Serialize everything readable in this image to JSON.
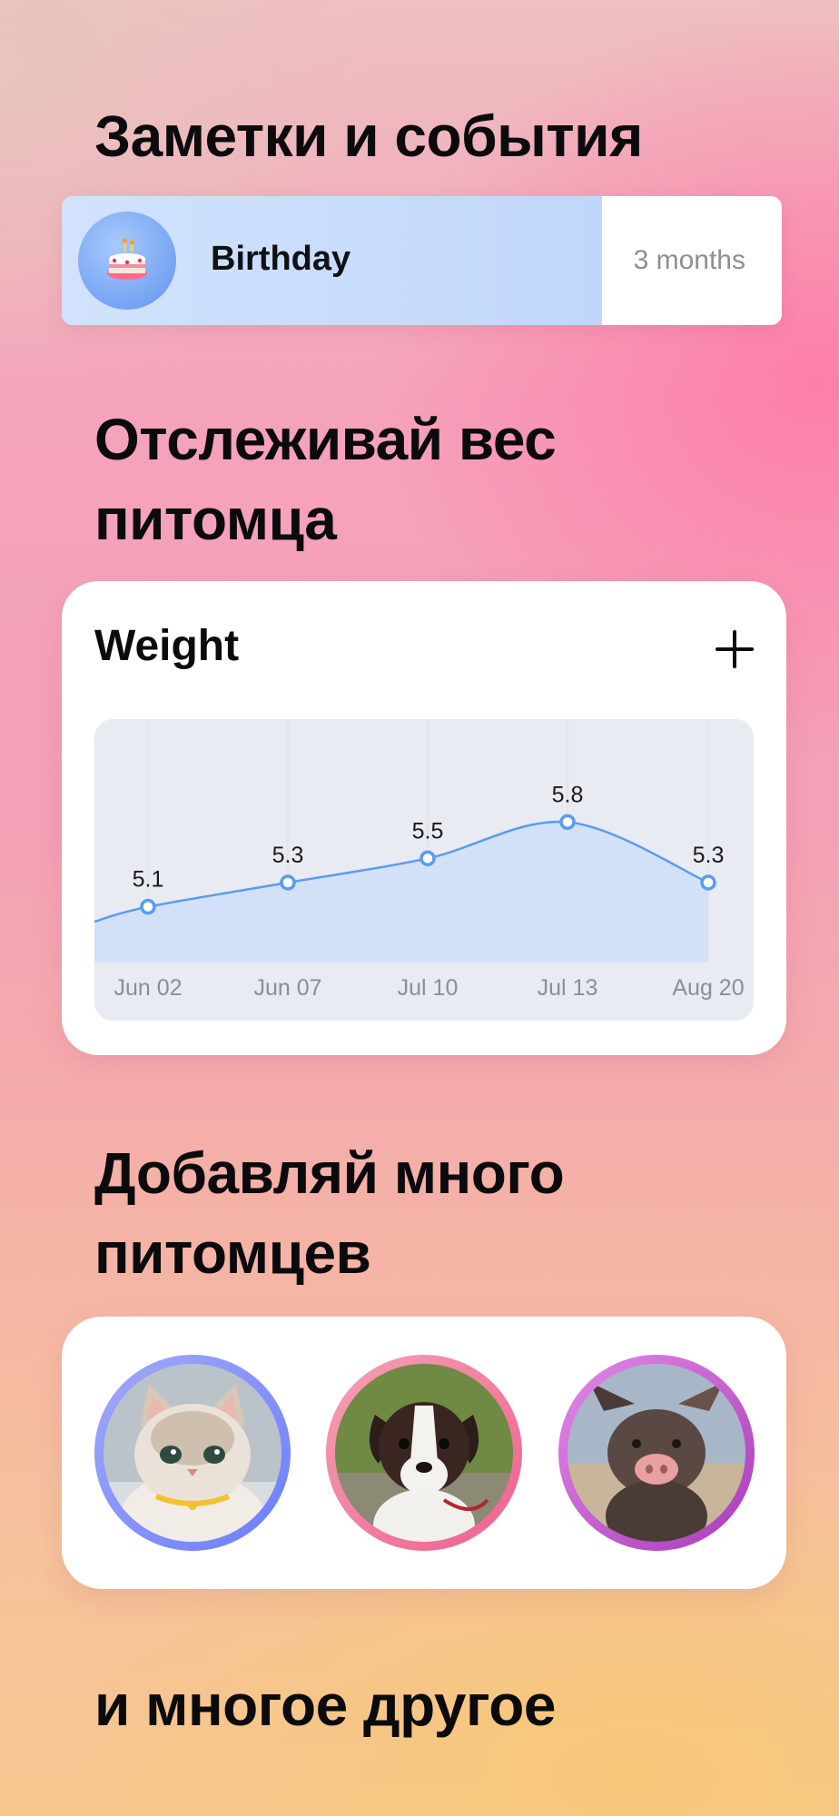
{
  "sections": {
    "events_heading": "Заметки и события",
    "weight_heading": "Отслеживай вес питомца",
    "pets_heading": "Добавляй много питомцев",
    "more_heading": "и многое другое"
  },
  "event": {
    "icon": "birthday-cake-icon",
    "title": "Birthday",
    "time_left": "3 months",
    "progress": 0.75
  },
  "weight": {
    "title": "Weight",
    "add_icon": "plus-icon"
  },
  "chart_data": {
    "type": "area",
    "title": "Weight",
    "x": [
      "Jun 02",
      "Jun 07",
      "Jul 10",
      "Jul 13",
      "Aug 20"
    ],
    "values": [
      5.1,
      5.3,
      5.5,
      5.8,
      5.3
    ],
    "data_labels": [
      "5.1",
      "5.3",
      "5.5",
      "5.8",
      "5.3"
    ],
    "ylim": [
      4.4,
      6.2
    ],
    "grid": true,
    "colors": {
      "line": "#5a9bf3",
      "fill": "#d3e1f8",
      "background": "#e8ebf1"
    }
  },
  "pets": [
    {
      "name": "cat",
      "ring_colors": [
        "#a3a9f7",
        "#6a7dff"
      ]
    },
    {
      "name": "dog",
      "ring_colors": [
        "#f4a1b4",
        "#ef5f8e"
      ]
    },
    {
      "name": "pig",
      "ring_colors": [
        "#e38ae8",
        "#a93ab8"
      ]
    }
  ]
}
